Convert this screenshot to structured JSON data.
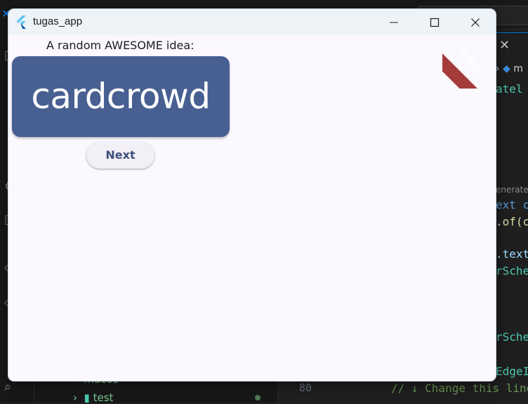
{
  "window": {
    "title": "tugas_app",
    "icons": {
      "app": "flutter-logo-icon",
      "minimize": "minimize-icon",
      "maximize": "maximize-icon",
      "close": "close-icon"
    }
  },
  "app": {
    "prompt": "A random AWESOME idea:",
    "idea": "cardcrowd",
    "next_label": "Next",
    "debug_banner": "DEBUG"
  },
  "colors": {
    "card": "#485f92",
    "card_text": "#ffffff",
    "button_bg": "#f2eff6",
    "button_text": "#3d4f7d",
    "debug_banner": "#a53b3b",
    "window_bg": "#fbf8fe",
    "titlebar_bg": "#eef3f8"
  },
  "background_editor": {
    "code_fragments": [
      "atel",
      "enerate",
      "ext c",
      ".of(co",
      ".textT",
      "rSchem",
      "rSchem",
      "EdgeIn",
      "// ↓ Change this line"
    ],
    "line_numbers": [
      "80"
    ],
    "explorer_items": [
      "macos",
      "test"
    ],
    "breadcrumb": "m",
    "tab_close": "✕"
  }
}
